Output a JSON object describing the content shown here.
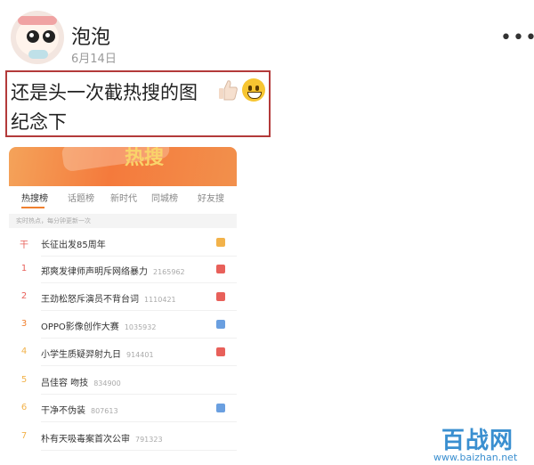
{
  "post": {
    "username": "泡泡",
    "date": "6月14日",
    "more_icon": "more-horizontal-icon",
    "text_line1": "还是头一次截热搜的图",
    "text_line2": "纪念下",
    "emojis": [
      "thumbs-up-icon",
      "grinning-face-icon"
    ],
    "highlight_color": "#b33a3a"
  },
  "screenshot": {
    "banner_title": "热搜",
    "tabs": [
      "热搜榜",
      "话题榜",
      "新时代",
      "同城榜",
      "好友搜"
    ],
    "active_tab": "热搜榜",
    "hint": "实时热点，每分钟更新一次",
    "accent": "#f08030",
    "items": [
      {
        "rank": "干",
        "title": "长征出发85周年",
        "count": "",
        "badge_color": "#f2b24a"
      },
      {
        "rank": "1",
        "title": "郑爽发律师声明斥网络暴力",
        "count": "2165962",
        "badge_color": "#e8605a"
      },
      {
        "rank": "2",
        "title": "王劲松怒斥演员不背台词",
        "count": "1110421",
        "badge_color": "#e8605a"
      },
      {
        "rank": "3",
        "title": "OPPO影像创作大赛",
        "count": "1035932",
        "badge_color": "#6a9fe0"
      },
      {
        "rank": "4",
        "title": "小学生质疑羿射九日",
        "count": "914401",
        "badge_color": "#e8605a"
      },
      {
        "rank": "5",
        "title": "吕佳容 吻技",
        "count": "834900",
        "badge_color": ""
      },
      {
        "rank": "6",
        "title": "干净不伪装",
        "count": "807613",
        "badge_color": "#6a9fe0"
      },
      {
        "rank": "7",
        "title": "朴有天吸毒案首次公审",
        "count": "791323",
        "badge_color": ""
      }
    ]
  },
  "watermark": {
    "logo_text": "百战网",
    "url": "www.baizhan.net"
  }
}
